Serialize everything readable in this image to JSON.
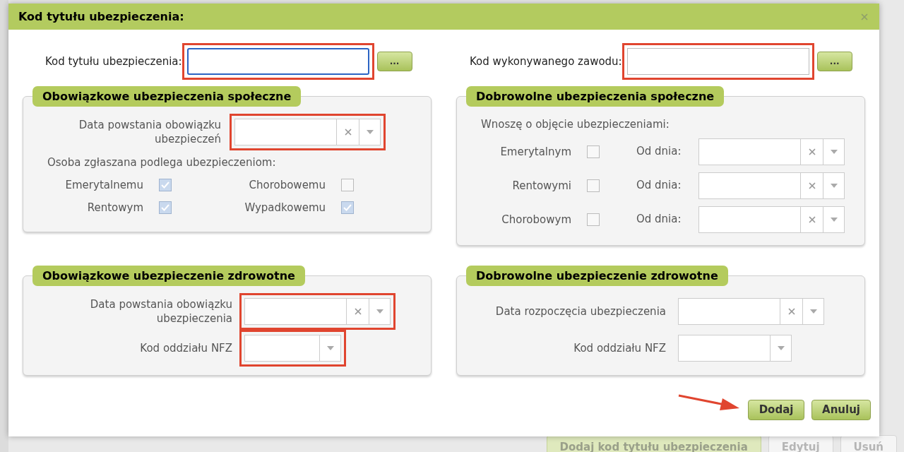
{
  "dialog": {
    "title": "Kod tytułu ubezpieczenia:"
  },
  "top_fields": [
    {
      "label": "Kod tytułu ubezpieczenia:",
      "focused": true,
      "highlighted": true,
      "button": "..."
    },
    {
      "label": "Kod wykonywanego zawodu:",
      "focused": false,
      "highlighted": true,
      "button": "..."
    }
  ],
  "mandatory_social": {
    "title": "Obowiązkowe ubezpieczenia społeczne",
    "date_label": "Data powstania obowiązku ubezpieczeń",
    "date_highlighted": true,
    "subtitle": "Osoba zgłaszana podlega ubezpieczeniom:",
    "checkboxes": [
      {
        "label": "Emerytalnemu",
        "checked": true
      },
      {
        "label": "Chorobowemu",
        "checked": false
      },
      {
        "label": "Rentowym",
        "checked": true
      },
      {
        "label": "Wypadkowemu",
        "checked": true
      }
    ]
  },
  "voluntary_social": {
    "title": "Dobrowolne ubezpieczenia społeczne",
    "subtitle": "Wnoszę o objęcie ubezpieczeniami:",
    "rows": [
      {
        "label": "Emerytalnym",
        "checked": false,
        "from_label": "Od dnia:"
      },
      {
        "label": "Rentowymi",
        "checked": false,
        "from_label": "Od dnia:"
      },
      {
        "label": "Chorobowym",
        "checked": false,
        "from_label": "Od dnia:"
      }
    ]
  },
  "mandatory_health": {
    "title": "Obowiązkowe ubezpieczenie zdrowotne",
    "date_label": "Data powstania obowiązku ubezpieczenia",
    "date_highlighted": true,
    "nfz_label": "Kod oddziału NFZ",
    "nfz_highlighted": true
  },
  "voluntary_health": {
    "title": "Dobrowolne ubezpieczenie zdrowotne",
    "date_label": "Data rozpoczęcia ubezpieczenia",
    "date_highlighted": false,
    "nfz_label": "Kod oddziału NFZ",
    "nfz_highlighted": false
  },
  "buttons": [
    {
      "label": "Dodaj",
      "pointed": true
    },
    {
      "label": "Anuluj",
      "pointed": false
    }
  ],
  "background_buttons": [
    {
      "label": "Dodaj kod tytułu ubezpieczenia",
      "primary": true
    },
    {
      "label": "Edytuj",
      "primary": false
    },
    {
      "label": "Usuń",
      "primary": false
    }
  ]
}
